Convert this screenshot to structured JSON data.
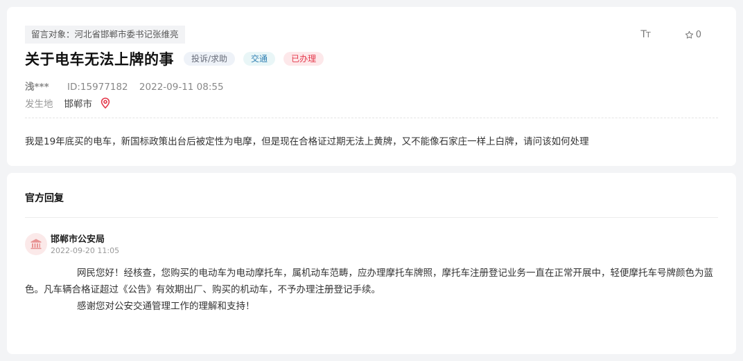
{
  "message": {
    "target": "留言对象：河北省邯郸市委书记张维亮",
    "title": "关于电车无法上牌的事",
    "tags": {
      "type": "投诉/求助",
      "domain": "交通",
      "status": "已办理"
    },
    "tools": {
      "font_big": "T",
      "font_small": "T",
      "favorite_count": "0"
    },
    "author": "浅***",
    "id": "ID:15977182",
    "time": "2022-09-11 08:55",
    "place_label": "发生地",
    "place_value": "邯郸市",
    "content": "我是19年底买的电车，新国标政策出台后被定性为电摩，但是现在合格证过期无法上黄牌，又不能像石家庄一样上白牌，请问该如何处理"
  },
  "reply": {
    "heading": "官方回复",
    "org": "邯郸市公安局",
    "time": "2022-09-20 11:05",
    "paragraphs": [
      "网民您好！经核查，您购买的电动车为电动摩托车，属机动车范畴，应办理摩托车牌照，摩托车注册登记业务一直在正常开展中，轻便摩托车号牌颜色为蓝色。凡车辆合格证超过《公告》有效期出厂、购买的机动车，不予办理注册登记手续。",
      "感谢您对公安交通管理工作的理解和支持！"
    ]
  },
  "colors": {
    "status_red": "#e4384b",
    "domain_blue": "#2f7fb3",
    "pin_red": "#e4384b"
  }
}
